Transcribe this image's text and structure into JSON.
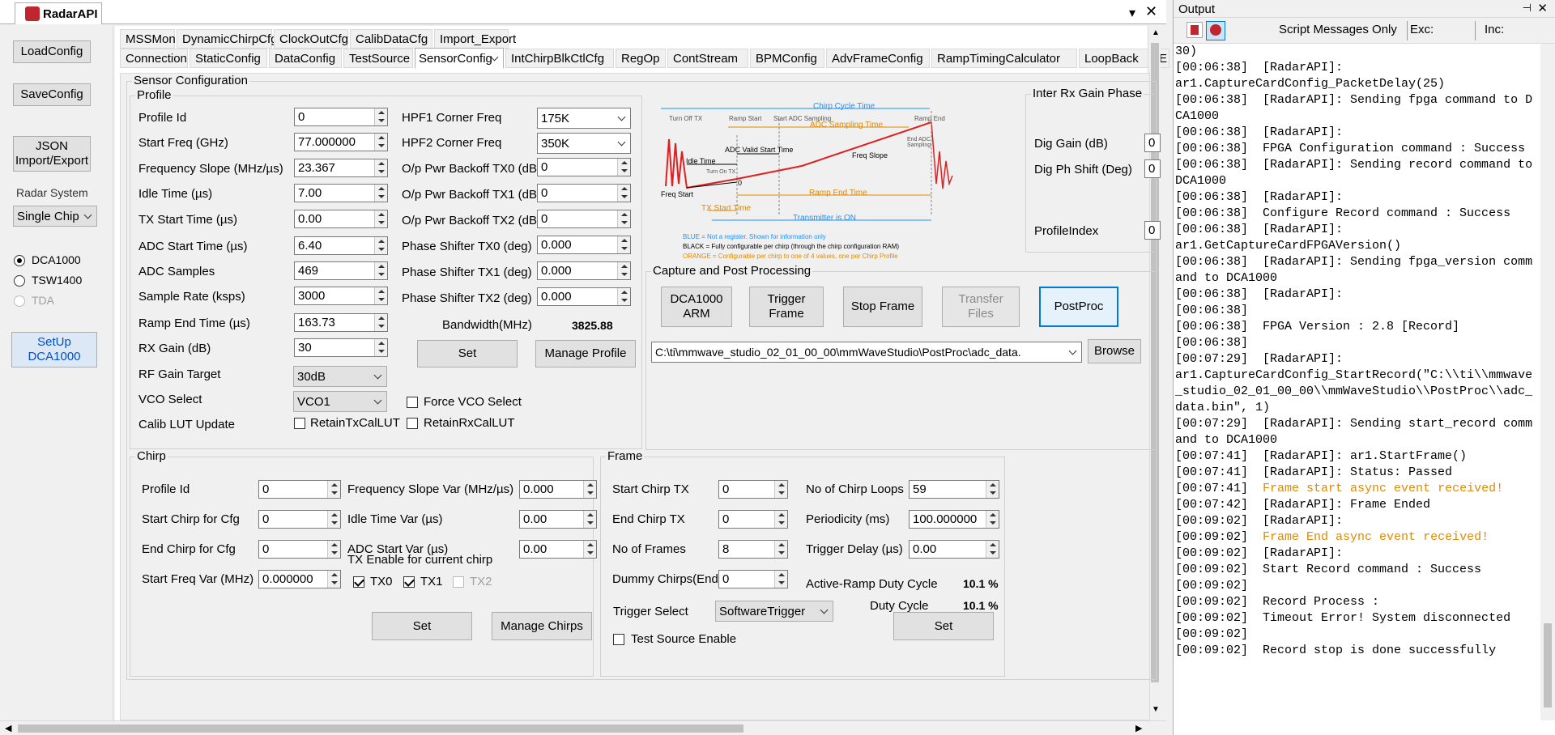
{
  "app_tab": "RadarAPI",
  "left": {
    "load": "LoadConfig",
    "save": "SaveConfig",
    "json1": "JSON",
    "json2": "Import/Export",
    "radar_system": "Radar System",
    "chip": "Single Chip",
    "dca1000": "DCA1000",
    "tsw1400": "TSW1400",
    "tda": "TDA",
    "setup1": "SetUp",
    "setup2": "DCA1000"
  },
  "tabs_row1": [
    "MSSMon",
    "DynamicChirpCfg",
    "ClockOutCfg",
    "CalibDataCfg",
    "Import_Export"
  ],
  "tabs_row2": [
    "Connection",
    "StaticConfig",
    "DataConfig",
    "TestSource",
    "SensorConfig",
    "IntChirpBlkCtlCfg",
    "RegOp",
    "ContStream",
    "BPMConfig",
    "AdvFrameConfig",
    "RampTimingCalculator",
    "LoopBack",
    "E"
  ],
  "sensor_title": "Sensor Configuration",
  "profile": {
    "title": "Profile",
    "labels": [
      "Profile Id",
      "Start Freq (GHz)",
      "Frequency Slope (MHz/µs)",
      "Idle Time (µs)",
      "TX Start Time (µs)",
      "ADC Start Time (µs)",
      "ADC Samples",
      "Sample Rate (ksps)",
      "Ramp End Time (µs)",
      "RX Gain (dB)",
      "RF Gain Target",
      "VCO Select",
      "Calib LUT Update"
    ],
    "values": [
      "0",
      "77.000000",
      "23.367",
      "7.00",
      "0.00",
      "6.40",
      "469",
      "3000",
      "163.73",
      "30"
    ],
    "rf_gain": "30dB",
    "vco": "VCO1",
    "right_labels": [
      "HPF1 Corner Freq",
      "HPF2 Corner Freq",
      "O/p Pwr Backoff TX0 (dB)",
      "O/p Pwr Backoff TX1 (dB)",
      "O/p Pwr Backoff TX2 (dB)",
      "Phase Shifter TX0 (deg)",
      "Phase Shifter TX1 (deg)",
      "Phase Shifter TX2 (deg)"
    ],
    "hpf1": "175K",
    "hpf2": "350K",
    "right_values": [
      "0",
      "0",
      "0",
      "0.000",
      "0.000",
      "0.000"
    ],
    "bandwidth_label": "Bandwidth(MHz)",
    "bandwidth": "3825.88",
    "set": "Set",
    "manage": "Manage Profile",
    "force_vco": "Force VCO Select",
    "retain_tx": "RetainTxCalLUT",
    "retain_rx": "RetainRxCalLUT"
  },
  "diagram": {
    "chirp_cycle": "Chirp Cycle Time",
    "turn_off": "Turn Off TX",
    "ramp_start": "Ramp Start",
    "start_adc": "Start ADC Sampling",
    "ramp_end": "Ramp End",
    "adc_sampling": "ADC Sampling Time",
    "end_adc": "End ADC Sampling",
    "adc_valid": "ADC Valid Start Time",
    "freq_slope": "Freq Slope",
    "idle": "Idle Time",
    "turn_on": "Turn On TX",
    "freq_start": "Freq Start",
    "ramp_end_time": "Ramp End Time",
    "tx_start": "TX Start Time",
    "tx_on": "Transmitter is ON",
    "zero": "0",
    "note_blue": "BLUE = Not a register. Shown for information only",
    "note_black": "BLACK = Fully configurable per chirp (through the chirp configuration RAM)",
    "note_orange": "ORANGE = Configurable per chirp to one of 4 values, one per Chirp Profile"
  },
  "inter_rx": {
    "title": "Inter Rx Gain Phase",
    "dig_gain": "Dig Gain (dB)",
    "dig_ph": "Dig Ph Shift (Deg)",
    "profile_index": "ProfileIndex",
    "v1": "0",
    "v2": "0",
    "v3": "0"
  },
  "capture": {
    "title": "Capture and Post Processing",
    "arm1": "DCA1000",
    "arm2": "ARM",
    "trig1": "Trigger",
    "trig2": "Frame",
    "stop": "Stop Frame",
    "xfer1": "Transfer",
    "xfer2": "Files",
    "post": "PostProc",
    "path": "C:\\ti\\mmwave_studio_02_01_00_00\\mmWaveStudio\\PostProc\\adc_data.",
    "browse": "Browse"
  },
  "chirp": {
    "title": "Chirp",
    "labels": [
      "Profile Id",
      "Start Chirp for Cfg",
      "End Chirp for Cfg",
      "Start Freq Var (MHz)"
    ],
    "values": [
      "0",
      "0",
      "0",
      "0.000000"
    ],
    "labels2": [
      "Frequency Slope Var (MHz/µs)",
      "Idle Time Var (µs)",
      "ADC Start Var (µs)"
    ],
    "values2": [
      "0.000",
      "0.00",
      "0.00"
    ],
    "tx_enable": "TX Enable for current chirp",
    "tx0": "TX0",
    "tx1": "TX1",
    "tx2": "TX2",
    "set": "Set",
    "manage": "Manage Chirps"
  },
  "frame": {
    "title": "Frame",
    "labels": [
      "Start Chirp TX",
      "End Chirp TX",
      "No of Frames",
      "Dummy Chirps(End)"
    ],
    "values": [
      "0",
      "0",
      "8",
      "0"
    ],
    "labels2": [
      "No of Chirp Loops",
      "Periodicity (ms)",
      "Trigger Delay (µs)"
    ],
    "values2": [
      "59",
      "100.000000",
      "0.00"
    ],
    "active_duty_label": "Active-Ramp Duty Cycle",
    "active_duty": "10.1 %",
    "trigger_label": "Trigger Select",
    "trigger": "SoftwareTrigger",
    "duty_label": "Duty Cycle",
    "duty": "10.1 %",
    "test_source": "Test Source Enable",
    "set": "Set"
  },
  "output": {
    "title": "Output",
    "filter": "Script Messages Only",
    "exc": "Exc:",
    "inc": "Inc:",
    "log": [
      {
        "t": "30)",
        "o": false
      },
      {
        "t": "[00:06:38]  [RadarAPI]:",
        "o": false
      },
      {
        "t": "ar1.CaptureCardConfig_PacketDelay(25)",
        "o": false
      },
      {
        "t": "[00:06:38]  [RadarAPI]: Sending fpga command to DCA1000",
        "o": false
      },
      {
        "t": "[00:06:38]  [RadarAPI]:",
        "o": false
      },
      {
        "t": "[00:06:38]  FPGA Configuration command : Success",
        "o": false
      },
      {
        "t": "[00:06:38]  [RadarAPI]: Sending record command to DCA1000",
        "o": false
      },
      {
        "t": "[00:06:38]  [RadarAPI]:",
        "o": false
      },
      {
        "t": "[00:06:38]  Configure Record command : Success",
        "o": false
      },
      {
        "t": "[00:06:38]  [RadarAPI]:",
        "o": false
      },
      {
        "t": "ar1.GetCaptureCardFPGAVersion()",
        "o": false
      },
      {
        "t": "[00:06:38]  [RadarAPI]: Sending fpga_version command to DCA1000",
        "o": false
      },
      {
        "t": "[00:06:38]  [RadarAPI]:",
        "o": false
      },
      {
        "t": "[00:06:38]",
        "o": false
      },
      {
        "t": "[00:06:38]  FPGA Version : 2.8 [Record]",
        "o": false
      },
      {
        "t": "[00:06:38]",
        "o": false
      },
      {
        "t": "[00:07:29]  [RadarAPI]:",
        "o": false
      },
      {
        "t": "ar1.CaptureCardConfig_StartRecord(\"C:\\\\ti\\\\mmwave_studio_02_01_00_00\\\\mmWaveStudio\\\\PostProc\\\\adc_data.bin\", 1)",
        "o": false
      },
      {
        "t": "[00:07:29]  [RadarAPI]: Sending start_record command to DCA1000",
        "o": false
      },
      {
        "t": "[00:07:41]  [RadarAPI]: ar1.StartFrame()",
        "o": false
      },
      {
        "t": "[00:07:41]  [RadarAPI]: Status: Passed",
        "o": false
      },
      {
        "t": "[00:07:41]  ",
        "o": false,
        "x": "Frame start async event received!"
      },
      {
        "t": "[00:07:42]  [RadarAPI]: Frame Ended",
        "o": false
      },
      {
        "t": "[00:09:02]  [RadarAPI]:",
        "o": false
      },
      {
        "t": "[00:09:02]  ",
        "o": false,
        "x": "Frame End async event received!"
      },
      {
        "t": "[00:09:02]  [RadarAPI]:",
        "o": false
      },
      {
        "t": "[00:09:02]  Start Record command : Success",
        "o": false
      },
      {
        "t": "[00:09:02]",
        "o": false
      },
      {
        "t": "[00:09:02]  Record Process :",
        "o": false
      },
      {
        "t": "[00:09:02]  Timeout Error! System disconnected",
        "o": false
      },
      {
        "t": "[00:09:02]",
        "o": false
      },
      {
        "t": "[00:09:02]  Record stop is done successfully",
        "o": false
      }
    ]
  },
  "colors": {
    "accent": "#0078d7",
    "orange": "#e08a00",
    "blue_diag": "#1e90ff",
    "red_diag": "#e02020"
  }
}
